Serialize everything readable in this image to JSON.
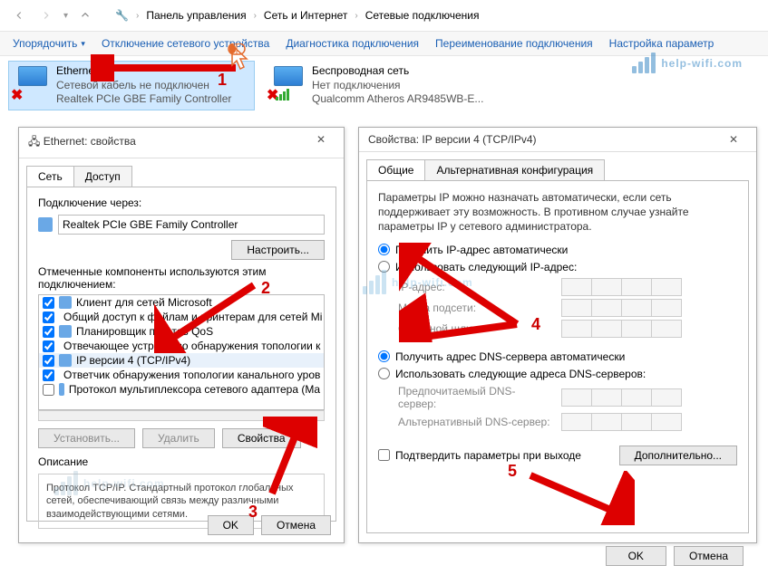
{
  "breadcrumb": {
    "root": "Панель управления",
    "l1": "Сеть и Интернет",
    "l2": "Сетевые подключения"
  },
  "toolbar": {
    "organize": "Упорядочить",
    "disable": "Отключение сетевого устройства",
    "diagnose": "Диагностика подключения",
    "rename": "Переименование подключения",
    "settings": "Настройка параметр"
  },
  "connections": {
    "eth": {
      "title": "Ethernet",
      "sub1": "Сетевой кабель не подключен",
      "sub2": "Realtek PCIe GBE Family Controller"
    },
    "wifi": {
      "title": "Беспроводная сеть",
      "sub1": "Нет подключения",
      "sub2": "Qualcomm Atheros AR9485WB-E..."
    }
  },
  "dlg1": {
    "title": "Ethernet: свойства",
    "tab_net": "Сеть",
    "tab_access": "Доступ",
    "connect_via": "Подключение через:",
    "adapter": "Realtek PCIe GBE Family Controller",
    "configure": "Настроить...",
    "components_lbl": "Отмеченные компоненты используются этим подключением:",
    "items": [
      "Клиент для сетей Microsoft",
      "Общий доступ к файлам и принтерам для сетей Mi",
      "Планировщик пакетов QoS",
      "Отвечающее устройство обнаружения топологии к",
      "IP версии 4 (TCP/IPv4)",
      "Ответчик обнаружения топологии канального уров",
      "Протокол мультиплексора сетевого адаптера (Ma"
    ],
    "install": "Установить...",
    "remove": "Удалить",
    "props": "Свойства",
    "desc_h": "Описание",
    "desc": "Протокол TCP/IP. Стандартный протокол глобальных сетей, обеспечивающий связь между различными взаимодействующими сетями.",
    "ok": "OK",
    "cancel": "Отмена"
  },
  "dlg2": {
    "title": "Свойства: IP версии 4 (TCP/IPv4)",
    "tab_general": "Общие",
    "tab_alt": "Альтернативная конфигурация",
    "info": "Параметры IP можно назначать автоматически, если сеть поддерживает эту возможность. В противном случае узнайте параметры IP у сетевого администратора.",
    "ip_auto": "Получить IP-адрес автоматически",
    "ip_manual": "Использовать следующий IP-адрес:",
    "ip_addr": "IP-адрес:",
    "mask": "Маска подсети:",
    "gw": "Основной шлюз:",
    "dns_auto": "Получить адрес DNS-сервера автоматически",
    "dns_manual": "Использовать следующие адреса DNS-серверов:",
    "dns_pref": "Предпочитаемый DNS-сервер:",
    "dns_alt": "Альтернативный DNS-сервер:",
    "confirm": "Подтвердить параметры при выходе",
    "advanced": "Дополнительно...",
    "ok": "OK",
    "cancel": "Отмена"
  },
  "watermark": "help-wifi.com",
  "ann": {
    "n1": "1",
    "n2": "2",
    "n3": "3",
    "n4": "4",
    "n5": "5"
  }
}
